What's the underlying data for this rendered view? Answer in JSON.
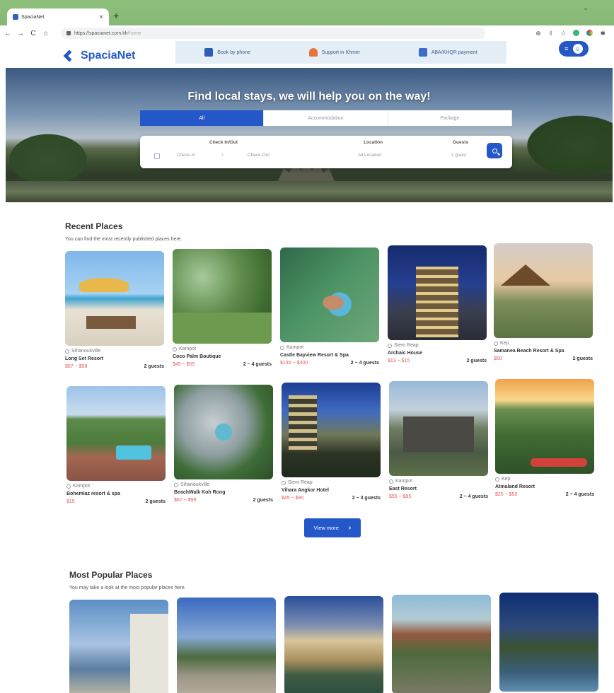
{
  "browser": {
    "tab_title": "SpaciaNet",
    "close_glyph": "×",
    "new_tab_glyph": "+",
    "minimize_glyph": "⌄",
    "url_host": "https://spacianet.com.kh",
    "url_path": "/home",
    "nav": {
      "back": "←",
      "forward": "→",
      "reload": "C",
      "home": "⌂"
    },
    "icons": {
      "zoom": "⊕",
      "share": "⇪",
      "bookmark": "☆",
      "extensions": "✱"
    }
  },
  "header": {
    "logo_text": "SpaciaNet",
    "info_items": [
      {
        "label": "Book by phone",
        "icon": "phone-icon"
      },
      {
        "label": "Support in Khmer",
        "icon": "support-icon"
      },
      {
        "label": "ABA/KHQR payment",
        "icon": "payment-icon"
      }
    ],
    "menu_glyph": "≡",
    "avatar_glyph": "☺"
  },
  "hero": {
    "title": "Find local stays, we will help you on the way!",
    "tabs": [
      "All",
      "Accommodation",
      "Package"
    ],
    "search": {
      "checkin_title": "Check In/Out",
      "checkin": "Check-In",
      "checkout": "Check-Out",
      "arrow": "›",
      "location_title": "Location",
      "location": "All Location",
      "guests_title": "Guests",
      "guests": "1 guest"
    }
  },
  "recent": {
    "title": "Recent Places",
    "subtitle": "You can find the most recently published places here.",
    "cards": [
      {
        "location": "Sihanoukville",
        "name": "Long Set Resort",
        "price": "$87 ~ $98",
        "guests": "2 guests"
      },
      {
        "location": "Kampot",
        "name": "Coco Palm Boutique",
        "price": "$45 ~ $55",
        "guests": "2 ~ 4 guests"
      },
      {
        "location": "Kampot",
        "name": "Castle Bayview Resort & Spa",
        "price": "$135 ~ $400",
        "guests": "2 ~ 4 guests"
      },
      {
        "location": "Siem Reap",
        "name": "Archaic House",
        "price": "$13 ~ $15",
        "guests": "2 guests"
      },
      {
        "location": "Kep",
        "name": "Samanea Beach Resort & Spa",
        "price": "$50",
        "guests": "2 guests"
      },
      {
        "location": "Kampot",
        "name": "Bohemiaz resort & spa",
        "price": "$15",
        "guests": "2 guests"
      },
      {
        "location": "Sihanoukville",
        "name": "BeachWalk Koh Rong",
        "price": "$67 ~ $99",
        "guests": "2 guests"
      },
      {
        "location": "Siem Reap",
        "name": "Vihara Angkor Hotel",
        "price": "$45 ~ $90",
        "guests": "2 ~ 3 guests"
      },
      {
        "location": "Kampot",
        "name": "East Resort",
        "price": "$55 ~ $95",
        "guests": "2 ~ 4 guests"
      },
      {
        "location": "Kep",
        "name": "Atmaland Resort",
        "price": "$25 ~ $50",
        "guests": "2 ~ 4 guests"
      }
    ],
    "view_more": "View more",
    "view_more_chevron": "›"
  },
  "popular": {
    "title": "Most Popular Places",
    "subtitle": "You may take a look at the most popular places here."
  }
}
